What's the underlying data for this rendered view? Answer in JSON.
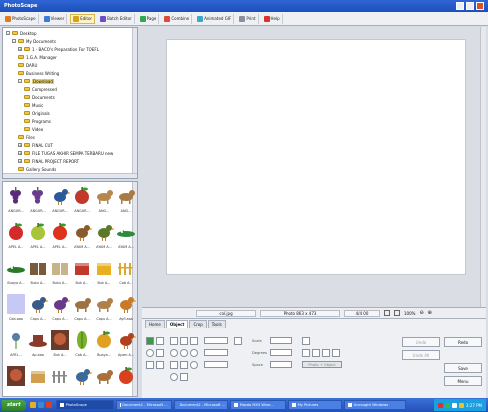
{
  "window": {
    "title": "PhotoScape"
  },
  "toolbar": {
    "items": [
      {
        "label": "PhotoScape",
        "icon": "home-icon",
        "color": "#e07a24"
      },
      {
        "label": "Viewer",
        "icon": "viewer-icon",
        "color": "#3a7bd5"
      },
      {
        "label": "Editor",
        "icon": "editor-icon",
        "color": "#d9a21c",
        "active": true
      },
      {
        "label": "Batch Editor",
        "icon": "batch-icon",
        "color": "#6a4fc4"
      },
      {
        "label": "Page",
        "icon": "page-icon",
        "color": "#2fa84f"
      },
      {
        "label": "Combine",
        "icon": "combine-icon",
        "color": "#d94c3a"
      },
      {
        "label": "Animated GIF",
        "icon": "gif-icon",
        "color": "#3aa7c9"
      },
      {
        "label": "Print",
        "icon": "print-icon",
        "color": "#8a8f99"
      },
      {
        "label": "Help",
        "icon": "help-icon",
        "color": "#d9322f"
      }
    ]
  },
  "tree": {
    "items": [
      {
        "label": "Desktop",
        "level": 0,
        "twisty": "-"
      },
      {
        "label": "My Documents",
        "level": 1,
        "twisty": "-"
      },
      {
        "label": "1 - BACO's Preparation For TOEFL",
        "level": 2,
        "twisty": "+"
      },
      {
        "label": "1.G.A. Manager",
        "level": 2
      },
      {
        "label": "DARU",
        "level": 2
      },
      {
        "label": "Business Writing",
        "level": 2
      },
      {
        "label": "Download",
        "level": 2,
        "twisty": "-",
        "selected": true
      },
      {
        "label": "Compressed",
        "level": 3
      },
      {
        "label": "Documents",
        "level": 3
      },
      {
        "label": "Music",
        "level": 3
      },
      {
        "label": "Originals",
        "level": 3
      },
      {
        "label": "Programs",
        "level": 3
      },
      {
        "label": "Video",
        "level": 3
      },
      {
        "label": "Files",
        "level": 2
      },
      {
        "label": "FINAL CUT",
        "level": 2,
        "twisty": "+"
      },
      {
        "label": "FILE TUGAS AKHIR SEMPA TERBARU new",
        "level": 2,
        "twisty": "+"
      },
      {
        "label": "FINAL PROJECT REPORT",
        "level": 2,
        "twisty": "+"
      },
      {
        "label": "Gallery Sounds",
        "level": 2
      }
    ]
  },
  "thumbnails": [
    {
      "caption": "ANGUR...",
      "shape": "grapes",
      "color": "#5b2a7a"
    },
    {
      "caption": "ANGUR...",
      "shape": "grapes",
      "color": "#6b3a8c"
    },
    {
      "caption": "ANGUR...",
      "shape": "bird",
      "color": "#2a5a9a"
    },
    {
      "caption": "ANGUR...",
      "shape": "fruit",
      "color": "#c0392b"
    },
    {
      "caption": "ANG...",
      "shape": "dog",
      "color": "#b8864a"
    },
    {
      "caption": "ANG...",
      "shape": "dog",
      "color": "#a87a44"
    },
    {
      "caption": "APEL A...",
      "shape": "fruit",
      "color": "#d42a2a"
    },
    {
      "caption": "APEL A...",
      "shape": "fruit",
      "color": "#a8c53a"
    },
    {
      "caption": "APEL A...",
      "shape": "fruit",
      "color": "#e0301e"
    },
    {
      "caption": "AYAM A...",
      "shape": "bird",
      "color": "#8a5a2a"
    },
    {
      "caption": "AYAM A...",
      "shape": "bird",
      "color": "#5a7a2a"
    },
    {
      "caption": "AYAM A...",
      "shape": "croc",
      "color": "#2f8a3a"
    },
    {
      "caption": "Buaya A...",
      "shape": "croc",
      "color": "#2a7a2a"
    },
    {
      "caption": "Buku A...",
      "shape": "book",
      "color": "#7a5a3a"
    },
    {
      "caption": "Buku A...",
      "shape": "book",
      "color": "#c8b48a"
    },
    {
      "caption": "Buk A...",
      "shape": "box",
      "color": "#c0392b"
    },
    {
      "caption": "Buk A...",
      "shape": "box",
      "color": "#e8b020"
    },
    {
      "caption": "Cab A...",
      "shape": "fence",
      "color": "#d8a830"
    },
    {
      "caption": "Cab.aaa",
      "shape": "blank",
      "color": "#c8c8f4"
    },
    {
      "caption": "Capu A...",
      "shape": "bird",
      "color": "#3a5a8a"
    },
    {
      "caption": "Capu A...",
      "shape": "bird",
      "color": "#6a3a8a"
    },
    {
      "caption": "Capu A...",
      "shape": "dog",
      "color": "#a07040"
    },
    {
      "caption": "Capu A...",
      "shape": "dog",
      "color": "#b0804a"
    },
    {
      "caption": "Ayfl.aaa",
      "shape": "bird",
      "color": "#c87a2a"
    },
    {
      "caption": "APEL...",
      "shape": "flower",
      "color": "#5a7aa8"
    },
    {
      "caption": "Ap.aaa",
      "shape": "hat",
      "color": "#8a3a2a"
    },
    {
      "caption": "Buk A...",
      "shape": "face",
      "color": "#c0603a"
    },
    {
      "caption": "Cab A...",
      "shape": "leaf",
      "color": "#7ab02a"
    },
    {
      "caption": "Buaya...",
      "shape": "fruit",
      "color": "#e0a020"
    },
    {
      "caption": "Ayam A...",
      "shape": "bird",
      "color": "#b04020"
    },
    {
      "caption": "",
      "shape": "face",
      "color": "#c05a3a"
    },
    {
      "caption": "",
      "shape": "box",
      "color": "#d0a050"
    },
    {
      "caption": "",
      "shape": "fence",
      "color": "#8a8a8a"
    },
    {
      "caption": "",
      "shape": "bird",
      "color": "#3a6a9a"
    },
    {
      "caption": "",
      "shape": "dog",
      "color": "#a8703a"
    },
    {
      "caption": "",
      "shape": "fruit",
      "color": "#d84020"
    }
  ],
  "status": {
    "filename": "col.jpg",
    "photo_size": "Photo 863 x 473",
    "zoom_info": "4/4 00",
    "zoom": "100%"
  },
  "panel": {
    "tabs": [
      {
        "label": "Home"
      },
      {
        "label": "Object",
        "active": true
      },
      {
        "label": "Crop"
      },
      {
        "label": "Tools"
      }
    ],
    "field_labels": [
      "Scale",
      "Degrees",
      "Space"
    ],
    "object_btn": "Photo + Object",
    "side_buttons": [
      {
        "label": "Undo",
        "disabled": true
      },
      {
        "label": "Redo",
        "disabled": false
      },
      {
        "label": "Undo All",
        "disabled": true
      },
      {
        "label": "Save",
        "disabled": false
      },
      {
        "label": "Menu",
        "disabled": false
      }
    ]
  },
  "taskbar": {
    "start": "start",
    "tasks": [
      {
        "label": "PhotoScape",
        "active": true
      },
      {
        "label": "Document1 - Microsoft ..."
      },
      {
        "label": "Document2 - Microsoft ..."
      },
      {
        "label": "Mazda MX5 Wine..."
      },
      {
        "label": "My Pictures"
      },
      {
        "label": "Uncaught Windows"
      }
    ],
    "clock": "3:27 PM"
  }
}
